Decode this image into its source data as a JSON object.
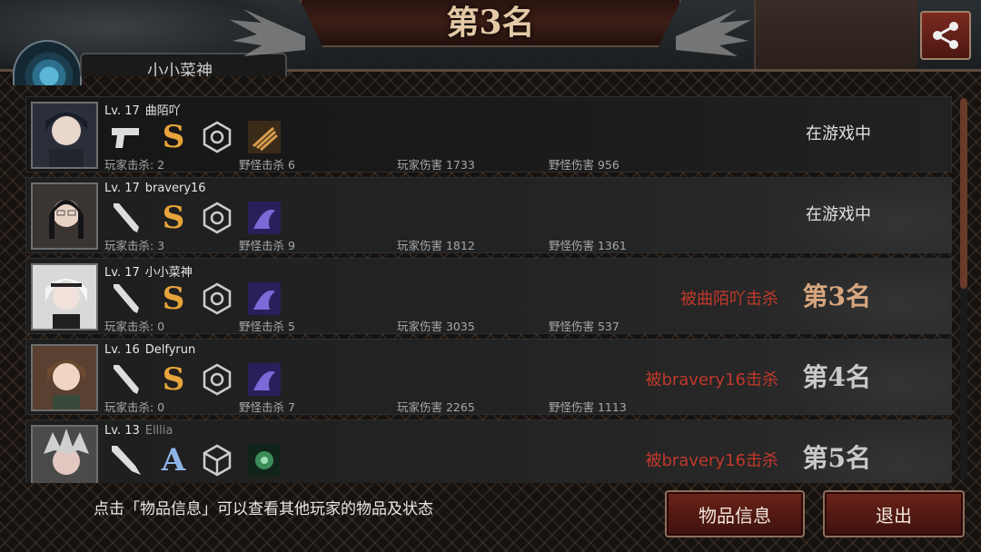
{
  "header": {
    "title": "第3名",
    "name_tab": "小小菜神"
  },
  "share": {
    "icon": "share-icon"
  },
  "labels": {
    "player_kills": "玩家击杀",
    "monster_kills": "野怪击杀",
    "player_damage": "玩家伤害",
    "monster_damage": "野怪伤害"
  },
  "players": [
    {
      "level": "Lv. 17",
      "name": "曲陌吖",
      "name_dim": false,
      "weapon_icon": "pistol-icon",
      "rank": "S",
      "rank_color": "#e7a43b",
      "armor_icon": "hexagon-armor-icon",
      "item_icon": "ammo-item-icon",
      "player_kills": "玩家击杀: 2",
      "monster_kills": "野怪击杀 6",
      "player_damage": "玩家伤害 1733",
      "monster_damage": "野怪伤害 956",
      "status": "在游戏中",
      "killed_by": "",
      "place": ""
    },
    {
      "level": "Lv. 17",
      "name": "bravery16",
      "name_dim": false,
      "weapon_icon": "bat-icon",
      "rank": "S",
      "rank_color": "#e7a43b",
      "armor_icon": "hexagon-armor-icon",
      "item_icon": "purple-item-icon",
      "player_kills": "玩家击杀: 3",
      "monster_kills": "野怪击杀 9",
      "player_damage": "玩家伤害 1812",
      "monster_damage": "野怪伤害 1361",
      "status": "在游戏中",
      "killed_by": "",
      "place": ""
    },
    {
      "level": "Lv. 17",
      "name": "小小菜神",
      "name_dim": false,
      "weapon_icon": "bat-icon",
      "rank": "S",
      "rank_color": "#e7a43b",
      "armor_icon": "hexagon-armor-icon",
      "item_icon": "purple-item-icon",
      "player_kills": "玩家击杀: 0",
      "monster_kills": "野怪击杀 5",
      "player_damage": "玩家伤害 3035",
      "monster_damage": "野怪伤害 537",
      "status": "",
      "killed_by": "被曲陌吖击杀",
      "place": "第3名"
    },
    {
      "level": "Lv. 16",
      "name": "Delfyrun",
      "name_dim": false,
      "weapon_icon": "bat-icon",
      "rank": "S",
      "rank_color": "#e7a43b",
      "armor_icon": "hexagon-armor-icon",
      "item_icon": "purple-item-icon",
      "player_kills": "玩家击杀: 0",
      "monster_kills": "野怪击杀 7",
      "player_damage": "玩家伤害 2265",
      "monster_damage": "野怪伤害 1113",
      "status": "",
      "killed_by": "被bravery16击杀",
      "place": "第4名"
    },
    {
      "level": "Lv. 13",
      "name": "Elllia",
      "name_dim": true,
      "weapon_icon": "knife-icon",
      "rank": "A",
      "rank_color": "#8fb4e8",
      "armor_icon": "cube-armor-icon",
      "item_icon": "green-item-icon",
      "player_kills": "",
      "monster_kills": "",
      "player_damage": "",
      "monster_damage": "",
      "status": "",
      "killed_by": "被bravery16击杀",
      "place": "第5名"
    }
  ],
  "footer": {
    "hint": "点击「物品信息」可以查看其他玩家的物品及状态",
    "info_button": "物品信息",
    "exit_button": "退出"
  }
}
